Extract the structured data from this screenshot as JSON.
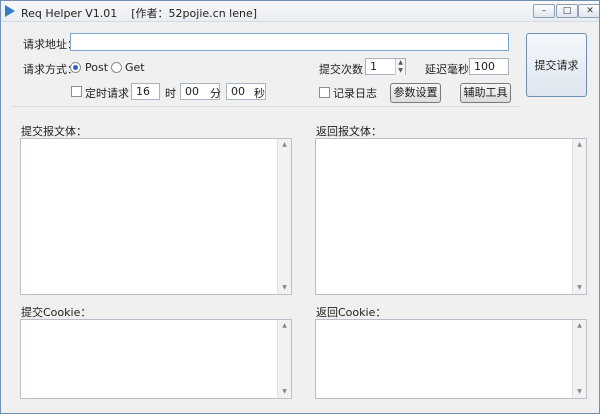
{
  "window": {
    "title": "Req Helper V1.01    [作者：52pojie.cn lene]",
    "min": "–",
    "max": "□",
    "close": "✕"
  },
  "request": {
    "url_label": "请求地址：",
    "url_value": "",
    "method_label": "请求方式：",
    "post": "Post",
    "get": "Get",
    "selected_method": "Post"
  },
  "timer": {
    "label": "定时请求：",
    "hour": "16",
    "hour_unit": "时",
    "minute": "00",
    "minute_unit": "分",
    "second": "00",
    "second_unit": "秒",
    "checked": false
  },
  "submit_count": {
    "label": "提交次数：",
    "value": "1"
  },
  "delay": {
    "label": "延迟毫秒：",
    "value": "100"
  },
  "log": {
    "label": "记录日志",
    "checked": false
  },
  "buttons": {
    "params": "参数设置",
    "tools": "辅助工具",
    "submit": "提交请求"
  },
  "panels": {
    "submit_body": "提交报文体：",
    "return_body": "返回报文体：",
    "submit_cookie": "提交Cookie：",
    "return_cookie": "返回Cookie："
  },
  "icons": {
    "app": "app-icon",
    "spin_up": "▲",
    "spin_down": "▼",
    "scroll_up": "▲",
    "scroll_down": "▼"
  }
}
